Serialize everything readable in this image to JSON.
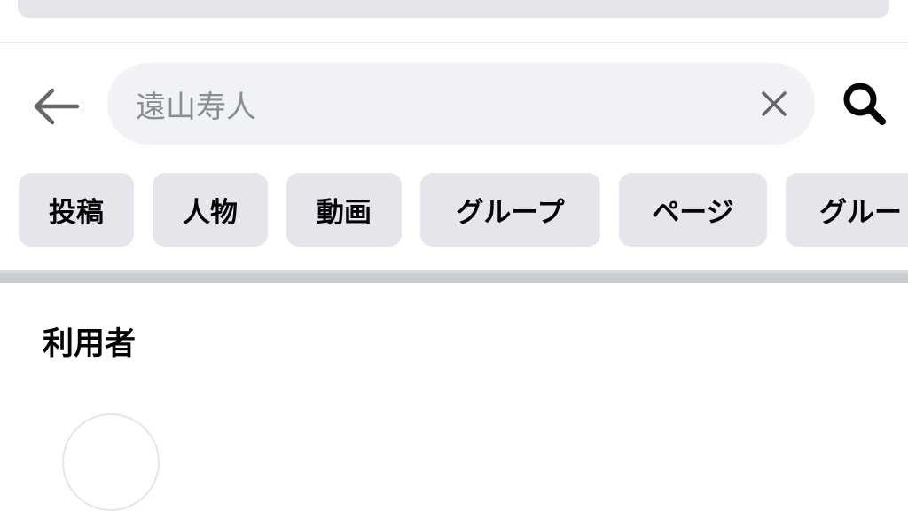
{
  "search": {
    "query": "遠山寿人",
    "back_icon": "arrow-left-icon",
    "clear_icon": "close-icon",
    "search_icon": "search-icon"
  },
  "filters": [
    {
      "label": "投稿"
    },
    {
      "label": "人物"
    },
    {
      "label": "動画"
    },
    {
      "label": "グループ"
    },
    {
      "label": "ページ"
    },
    {
      "label": "グルー"
    }
  ],
  "results": {
    "section_title": "利用者"
  },
  "colors": {
    "chip_bg": "#e4e6eb",
    "search_bg": "#f0f2f5",
    "placeholder_text": "#8a8d91",
    "primary_text": "#050505",
    "separator": "#c9ccd1"
  }
}
